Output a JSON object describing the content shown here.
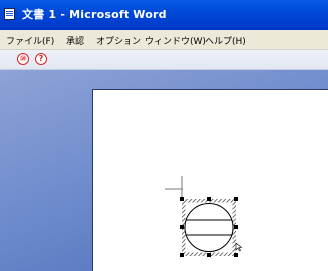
{
  "window": {
    "title": "文書 1 - Microsoft Word"
  },
  "menu": {
    "items": [
      "ファイル(F)",
      "承認",
      "オプション",
      "ウィンドウ(W)",
      "ヘルプ(H)"
    ]
  },
  "toolbar": {
    "buttons": [
      {
        "label": "⑩",
        "icon": "circled-ten-icon"
      },
      {
        "label": "?",
        "icon": "help-icon"
      }
    ]
  },
  "colors": {
    "titlebar": "#0047d6",
    "workspace": "#6f8ccd",
    "accent_red": "#dd2222"
  }
}
